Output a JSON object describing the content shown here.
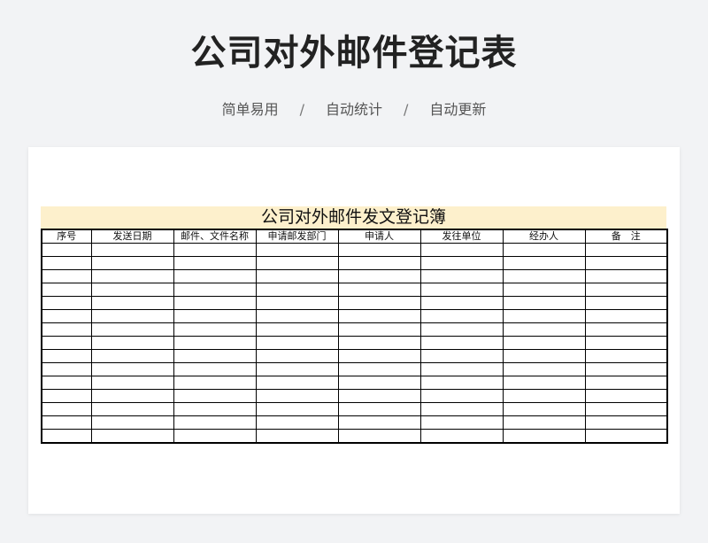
{
  "header": {
    "title": "公司对外邮件登记表",
    "tags": [
      "简单易用",
      "自动统计",
      "自动更新"
    ],
    "separator": "/"
  },
  "sheet": {
    "title": "公司对外邮件发文登记簿",
    "columns": [
      "序号",
      "发送日期",
      "邮件、文件名称",
      "申请邮发部门",
      "申请人",
      "发往单位",
      "经办人",
      "备　注"
    ],
    "rows": [
      [
        "",
        "",
        "",
        "",
        "",
        "",
        "",
        ""
      ],
      [
        "",
        "",
        "",
        "",
        "",
        "",
        "",
        ""
      ],
      [
        "",
        "",
        "",
        "",
        "",
        "",
        "",
        ""
      ],
      [
        "",
        "",
        "",
        "",
        "",
        "",
        "",
        ""
      ],
      [
        "",
        "",
        "",
        "",
        "",
        "",
        "",
        ""
      ],
      [
        "",
        "",
        "",
        "",
        "",
        "",
        "",
        ""
      ],
      [
        "",
        "",
        "",
        "",
        "",
        "",
        "",
        ""
      ],
      [
        "",
        "",
        "",
        "",
        "",
        "",
        "",
        ""
      ],
      [
        "",
        "",
        "",
        "",
        "",
        "",
        "",
        ""
      ],
      [
        "",
        "",
        "",
        "",
        "",
        "",
        "",
        ""
      ],
      [
        "",
        "",
        "",
        "",
        "",
        "",
        "",
        ""
      ],
      [
        "",
        "",
        "",
        "",
        "",
        "",
        "",
        ""
      ],
      [
        "",
        "",
        "",
        "",
        "",
        "",
        "",
        ""
      ],
      [
        "",
        "",
        "",
        "",
        "",
        "",
        "",
        ""
      ],
      [
        "",
        "",
        "",
        "",
        "",
        "",
        "",
        ""
      ]
    ]
  },
  "colors": {
    "background": "#f2f3f5",
    "title_band": "#fdf0cc",
    "grid": "#000000"
  }
}
